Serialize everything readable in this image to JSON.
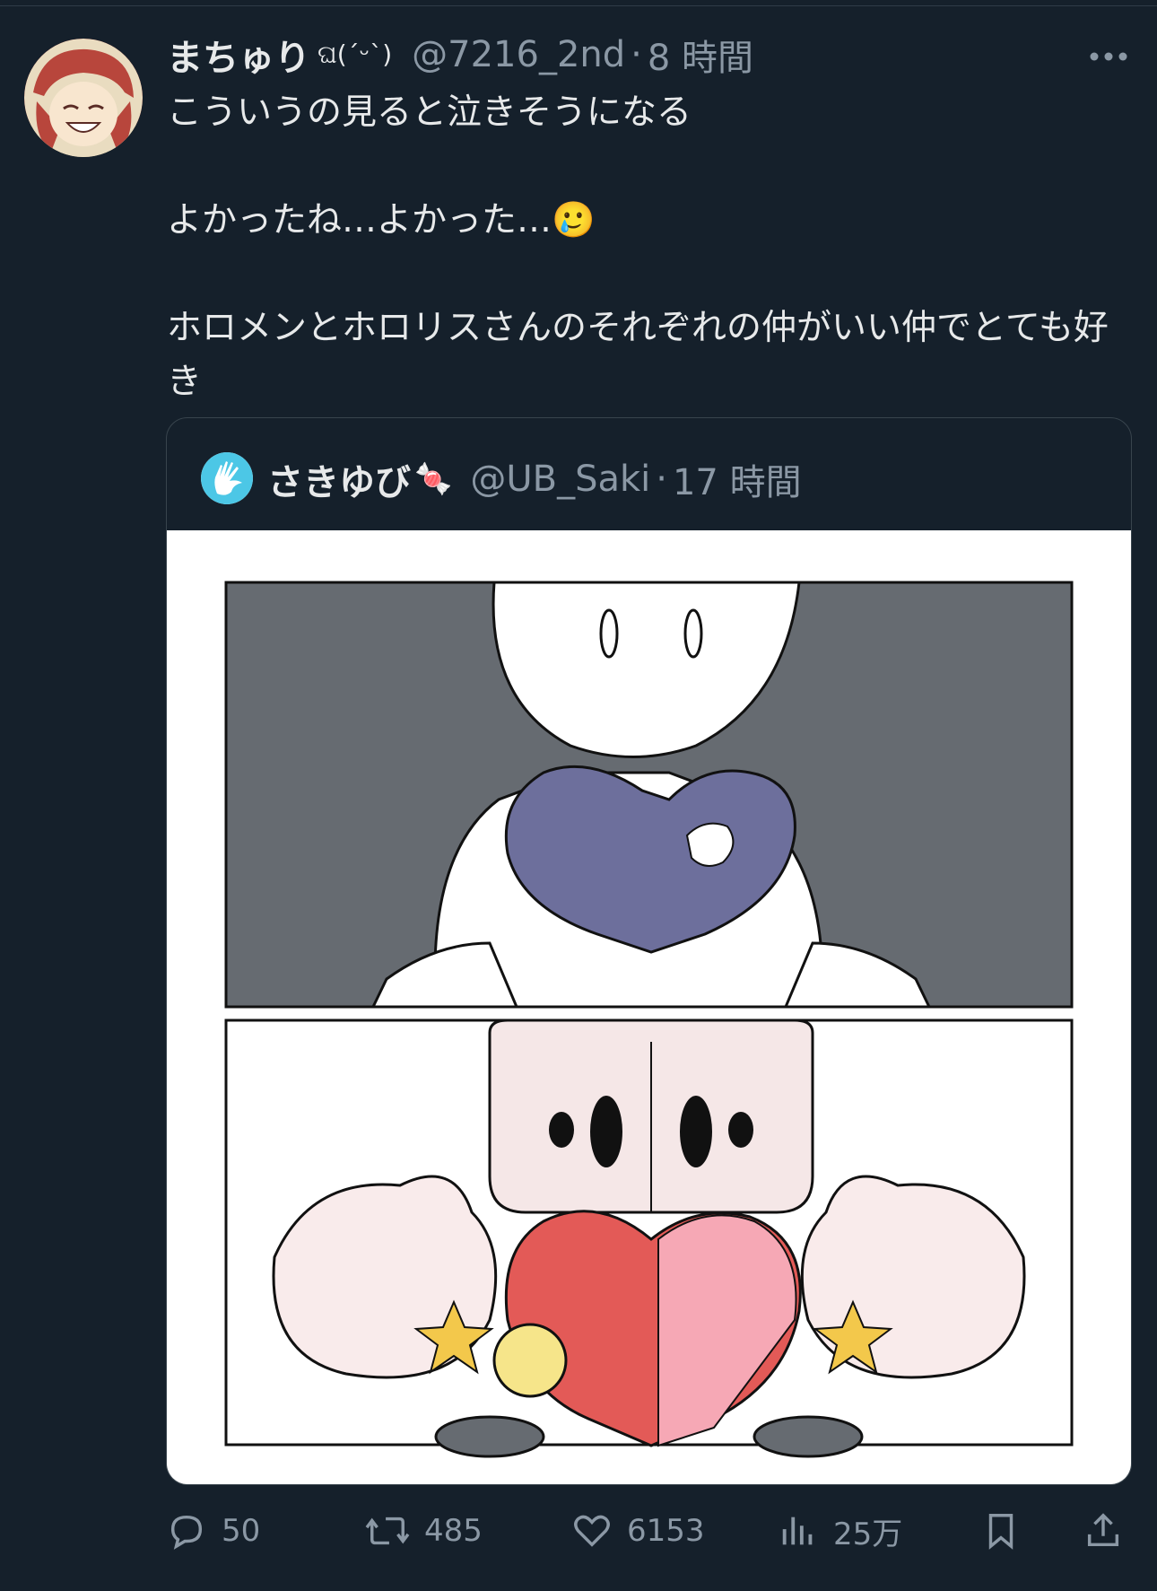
{
  "author": {
    "display_name": "まちゅり",
    "name_emoji": "ଘ(ˊᵕˋ)",
    "handle": "@7216_2nd",
    "separator": "·",
    "time": "8 時間"
  },
  "tweet": {
    "text": "こういうの見ると泣きそうになる\n\nよかったね…よかった…🥲\n\nホロメンとホロリスさんのそれぞれの仲がいい仲でとても好き"
  },
  "quote": {
    "display_name": "さきゆび",
    "name_emoji": "🍬",
    "handle": "@UB_Saki",
    "separator": "·",
    "time": "17 時間"
  },
  "actions": {
    "replies": "50",
    "retweets": "485",
    "likes": "6153",
    "views": "25万"
  },
  "colors": {
    "background": "#15202b",
    "text": "#e7e9ea",
    "muted": "#8b98a5",
    "border": "#38444d"
  },
  "icons": [
    "more-icon",
    "reply-icon",
    "retweet-icon",
    "like-icon",
    "views-icon",
    "bookmark-icon",
    "share-icon"
  ]
}
